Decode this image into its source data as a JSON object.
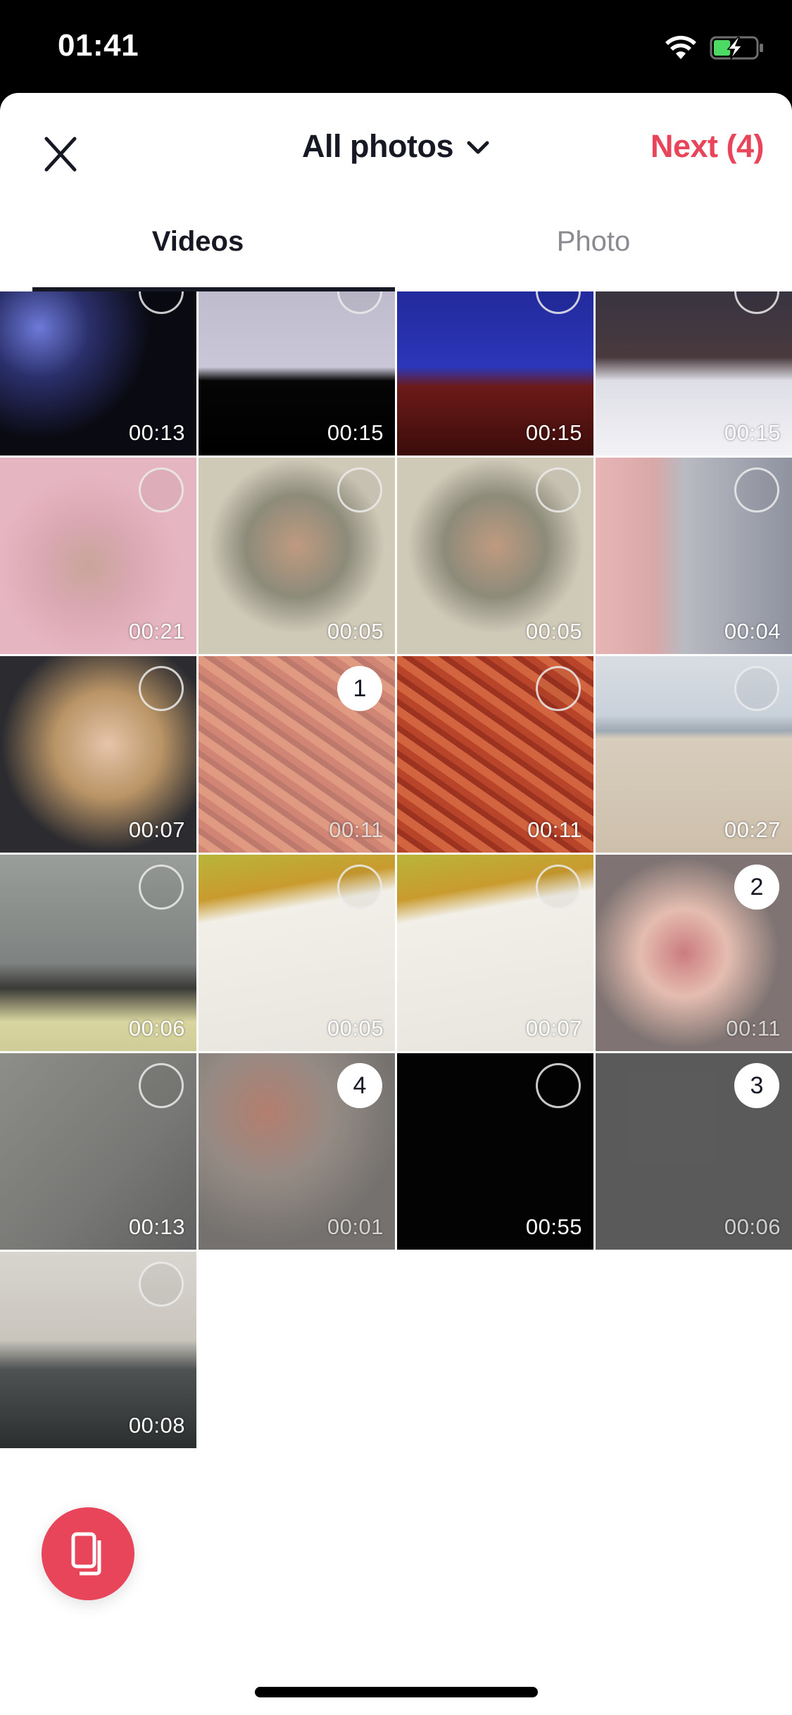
{
  "status_bar": {
    "time": "01:41",
    "wifi": "wifi-icon",
    "battery": {
      "icon": "battery-charging-icon",
      "level_fraction": 0.4,
      "charging": true,
      "fill_color": "#4CD964"
    }
  },
  "header": {
    "close_icon": "close-icon",
    "title": "All photos",
    "title_icon": "chevron-down-icon",
    "next_label": "Next (4)",
    "accent_color": "#E8445A"
  },
  "tabs": [
    {
      "label": "Videos",
      "active": true
    },
    {
      "label": "Photo",
      "active": false
    }
  ],
  "grid": {
    "items": [
      {
        "duration": "00:13",
        "selected": null,
        "thumb": "dark-concert-stage"
      },
      {
        "duration": "00:15",
        "selected": null,
        "thumb": "sketch-drawing-screen"
      },
      {
        "duration": "00:15",
        "selected": null,
        "thumb": "blue-screen-red-fabric"
      },
      {
        "duration": "00:15",
        "selected": null,
        "thumb": "arm-closeup-white-bg"
      },
      {
        "duration": "00:21",
        "selected": null,
        "thumb": "man-pink-background"
      },
      {
        "duration": "00:05",
        "selected": null,
        "thumb": "man-headphones-room"
      },
      {
        "duration": "00:05",
        "selected": null,
        "thumb": "man-headphones-room"
      },
      {
        "duration": "00:04",
        "selected": null,
        "thumb": "interview-record-shelf"
      },
      {
        "duration": "00:07",
        "selected": null,
        "thumb": "woman-selfie-mall"
      },
      {
        "duration": "00:11",
        "selected": 1,
        "thumb": "red-snack-closeup"
      },
      {
        "duration": "00:11",
        "selected": null,
        "thumb": "red-snack-closeup"
      },
      {
        "duration": "00:27",
        "selected": null,
        "thumb": "beach-person"
      },
      {
        "duration": "00:06",
        "selected": null,
        "thumb": "street-from-car"
      },
      {
        "duration": "00:05",
        "selected": null,
        "thumb": "wine-menu"
      },
      {
        "duration": "00:07",
        "selected": null,
        "thumb": "wine-menu"
      },
      {
        "duration": "00:11",
        "selected": 2,
        "thumb": "costume-red-body"
      },
      {
        "duration": "00:13",
        "selected": null,
        "thumb": "floor-feet"
      },
      {
        "duration": "00:01",
        "selected": 4,
        "thumb": "dark-party"
      },
      {
        "duration": "00:55",
        "selected": null,
        "thumb": "black-frame"
      },
      {
        "duration": "00:06",
        "selected": 3,
        "thumb": "black-frame"
      },
      {
        "duration": "00:08",
        "selected": null,
        "thumb": "stairs-person"
      }
    ]
  },
  "fab": {
    "icon": "multi-select-icon"
  }
}
